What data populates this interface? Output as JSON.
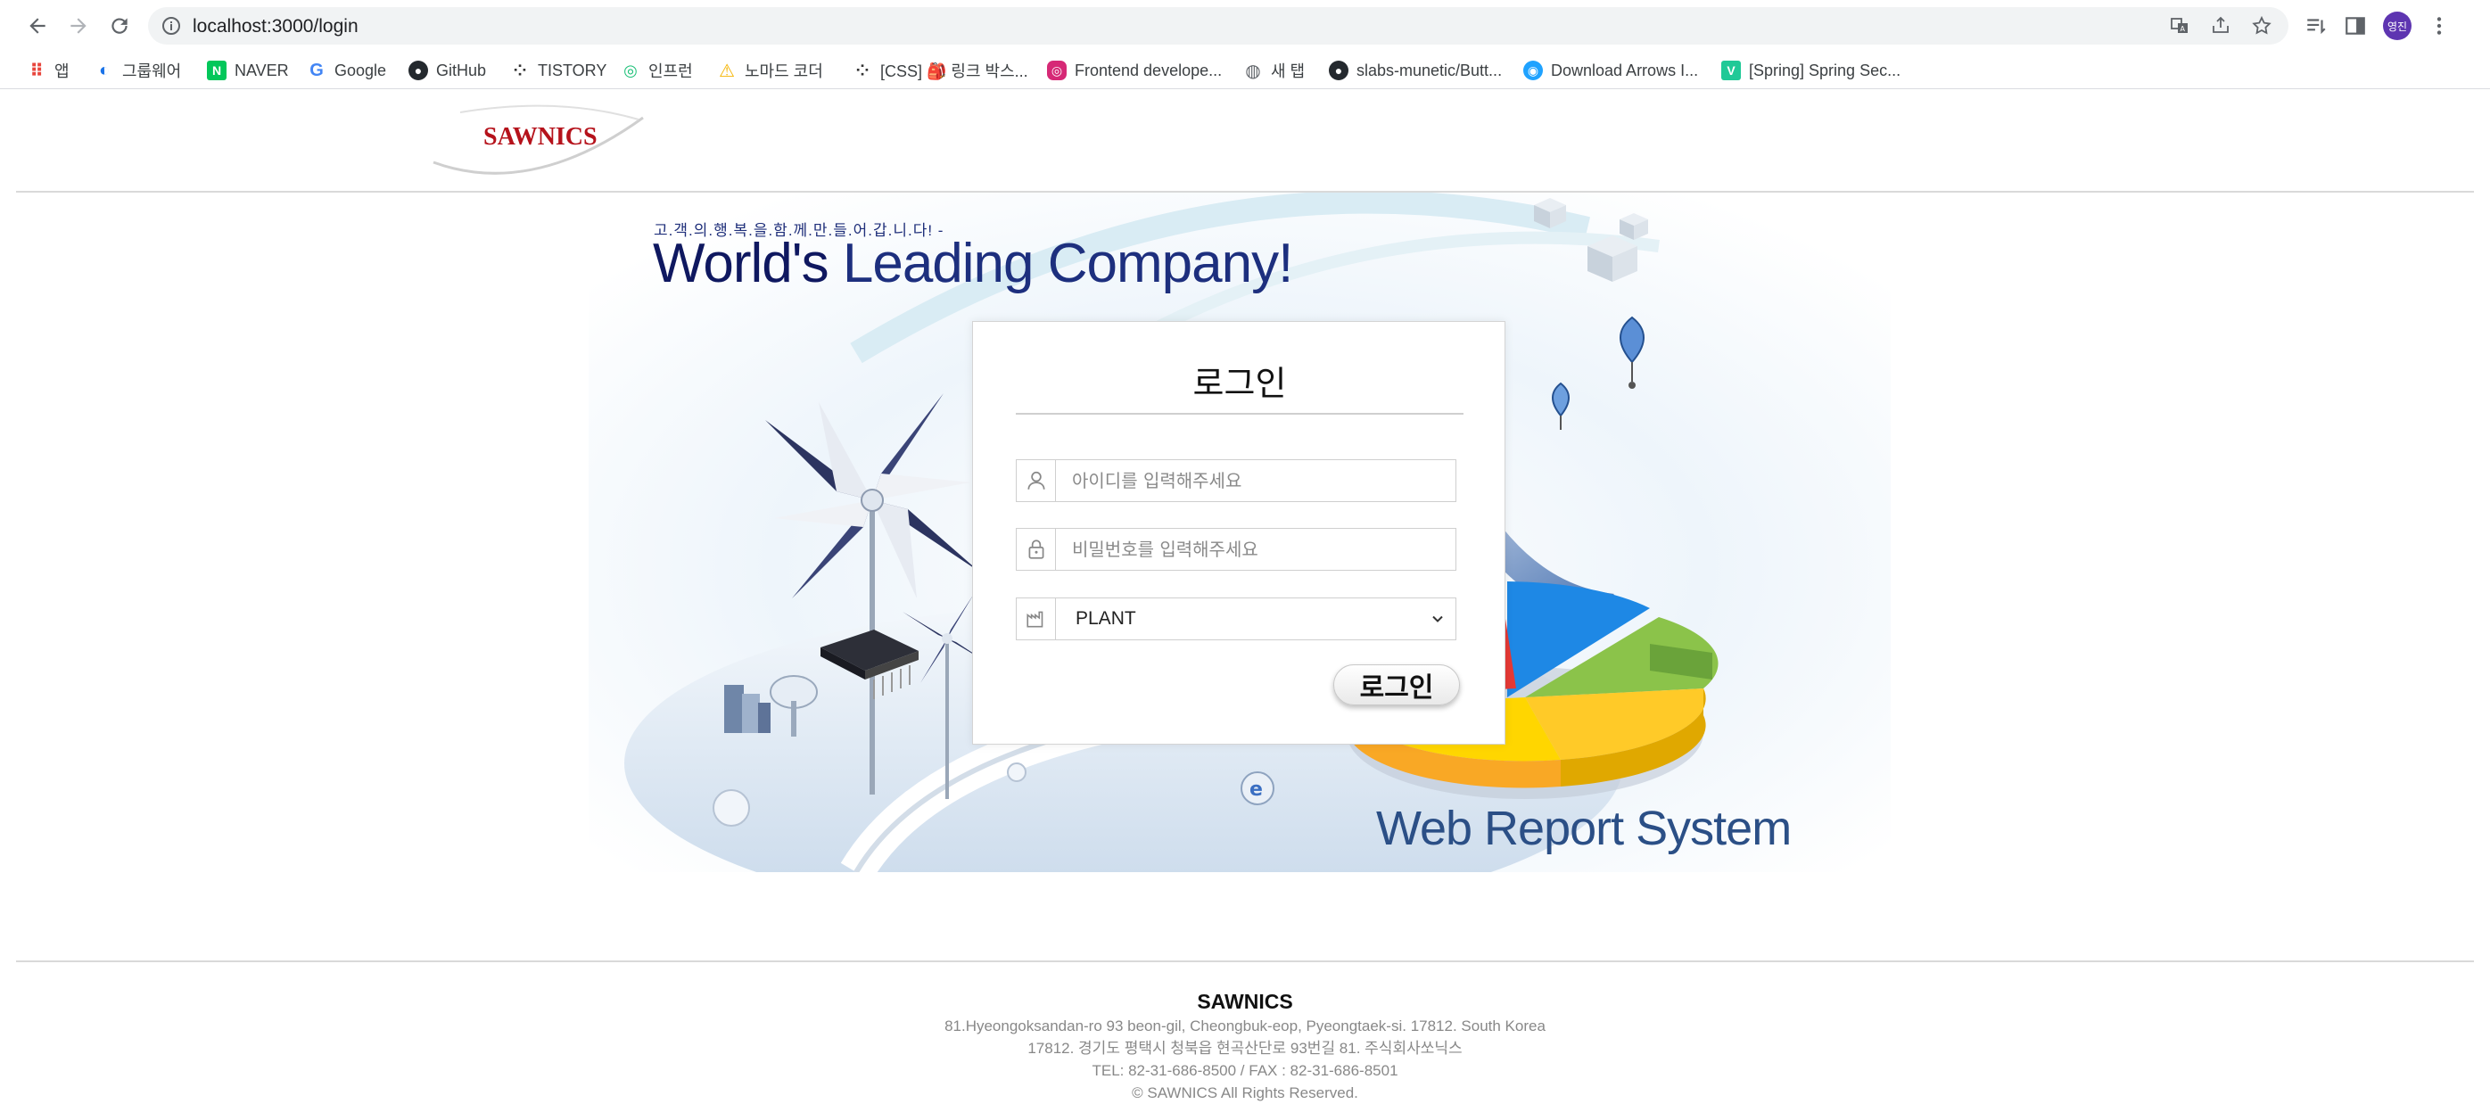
{
  "browser": {
    "url": "localhost:3000/login",
    "profile_initials": "영진",
    "bookmarks": [
      {
        "label": "앱",
        "icon": "apps-grid-icon",
        "color": "#e8453c"
      },
      {
        "label": "그룹웨어",
        "icon": "groupware-icon",
        "color": "#1a73e8"
      },
      {
        "label": "NAVER",
        "icon": "naver-icon",
        "color": "#03c75a"
      },
      {
        "label": "Google",
        "icon": "google-icon",
        "color": "#4285f4"
      },
      {
        "label": "GitHub",
        "icon": "github-icon",
        "color": "#24292e"
      },
      {
        "label": "TISTORY",
        "icon": "tistory-icon",
        "color": "#333333"
      },
      {
        "label": "인프런",
        "icon": "inflearn-icon",
        "color": "#1dc078"
      },
      {
        "label": "노마드 코더",
        "icon": "nomad-coders-icon",
        "color": "#f5b400"
      },
      {
        "label": "[CSS] 🎒 링크 박스...",
        "icon": "tistory-icon",
        "color": "#333333"
      },
      {
        "label": "Frontend develope...",
        "icon": "instagram-icon",
        "color": "#d62976"
      },
      {
        "label": "새 탭",
        "icon": "globe-icon",
        "color": "#5f6368"
      },
      {
        "label": "slabs-munetic/Butt...",
        "icon": "github-icon",
        "color": "#24292e"
      },
      {
        "label": "Download Arrows I...",
        "icon": "download-site-icon",
        "color": "#1fa2ff"
      },
      {
        "label": "[Spring] Spring Sec...",
        "icon": "velog-icon",
        "color": "#20c997"
      }
    ]
  },
  "header": {
    "logo_text": "SAWNICS"
  },
  "hero": {
    "tagline": "고.객.의.행.복.을.함.께.만.들.어.갑.니.다! -",
    "headline_a": "World's",
    "headline_b": " Leading Company!",
    "system_name": "Web Report System"
  },
  "login": {
    "title": "로그인",
    "id_placeholder": "아이디를 입력해주세요",
    "pw_placeholder": "비밀번호를 입력해주세요",
    "plant_selected": "PLANT",
    "submit_label": "로그인"
  },
  "footer": {
    "company": "SAWNICS",
    "address_en": "81.Hyeongoksandan-ro 93 beon-gil, Cheongbuk-eop, Pyeongtaek-si. 17812. South Korea",
    "address_ko": "17812. 경기도 평택시 청북읍 현곡산단로 93번길 81. 주식회사쏘닉스",
    "contact": "TEL: 82-31-686-8500 / FAX : 82-31-686-8501",
    "copyright": "© SAWNICS All Rights Reserved."
  }
}
